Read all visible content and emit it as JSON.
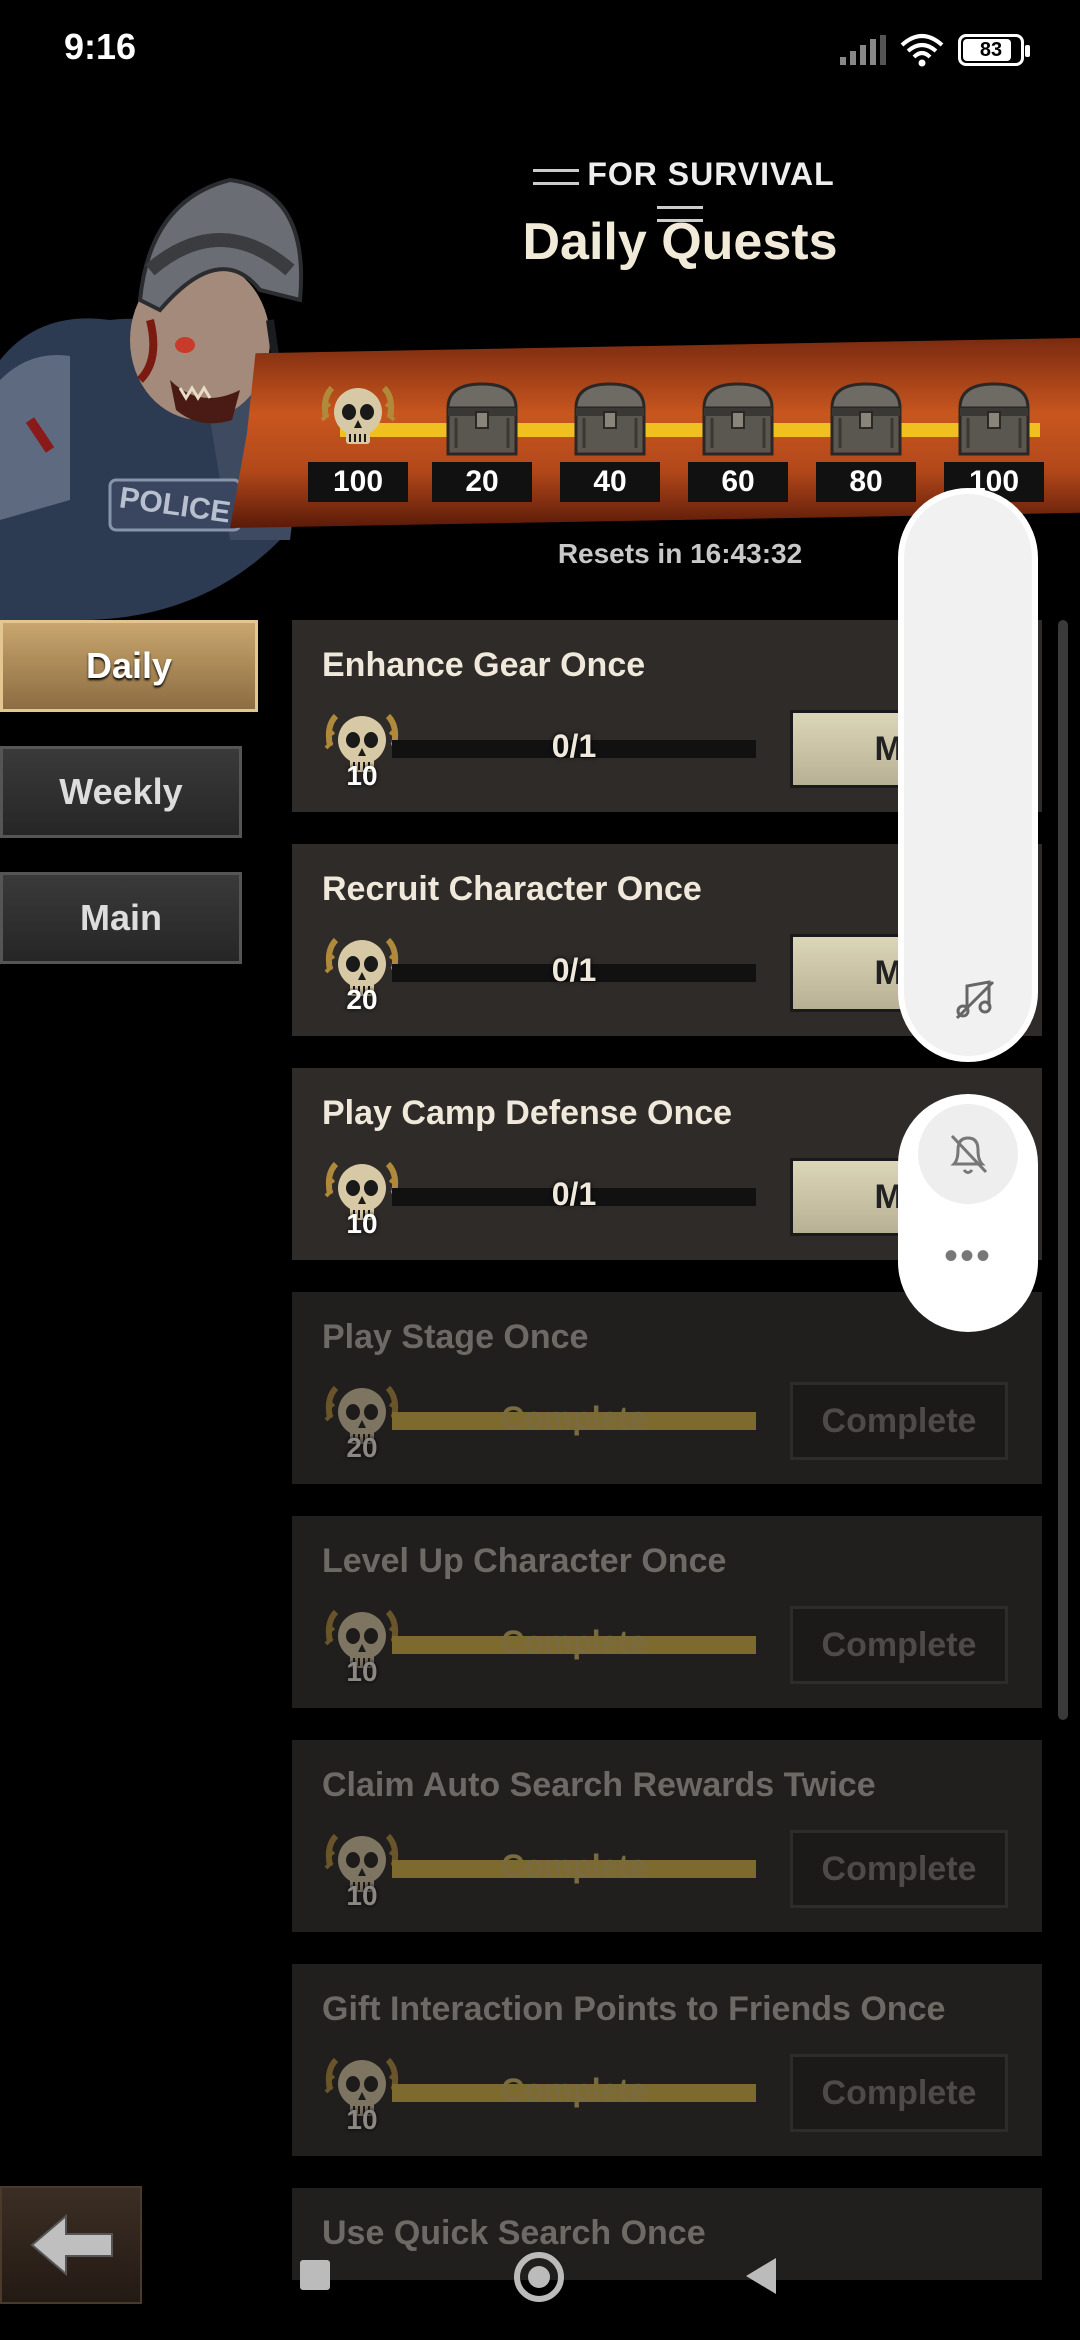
{
  "status": {
    "time": "9:16",
    "battery": "83"
  },
  "header": {
    "subtitle": "FOR SURVIVAL",
    "title": "Daily Quests"
  },
  "milestones": [
    "100",
    "20",
    "40",
    "60",
    "80",
    "100"
  ],
  "resets_text": "Resets in 16:43:32",
  "tabs": {
    "daily": "Daily",
    "weekly": "Weekly",
    "main": "Main"
  },
  "quests": [
    {
      "title": "Enhance Gear Once",
      "reward": "10",
      "progress": "0/1",
      "action": "Mo"
    },
    {
      "title": "Recruit Character Once",
      "reward": "20",
      "progress": "0/1",
      "action": "Mo"
    },
    {
      "title": "Play Camp Defense Once",
      "reward": "10",
      "progress": "0/1",
      "action": "Mo"
    },
    {
      "title": "Play Stage Once",
      "reward": "20",
      "progress": "Complete",
      "action": "Complete"
    },
    {
      "title": "Level Up Character Once",
      "reward": "10",
      "progress": "Complete",
      "action": "Complete"
    },
    {
      "title": "Claim Auto Search Rewards Twice",
      "reward": "10",
      "progress": "Complete",
      "action": "Complete"
    },
    {
      "title": "Gift Interaction Points to Friends Once",
      "reward": "10",
      "progress": "Complete",
      "action": "Complete"
    },
    {
      "title": "Use Quick Search Once"
    }
  ],
  "float": {
    "more": "•••"
  }
}
